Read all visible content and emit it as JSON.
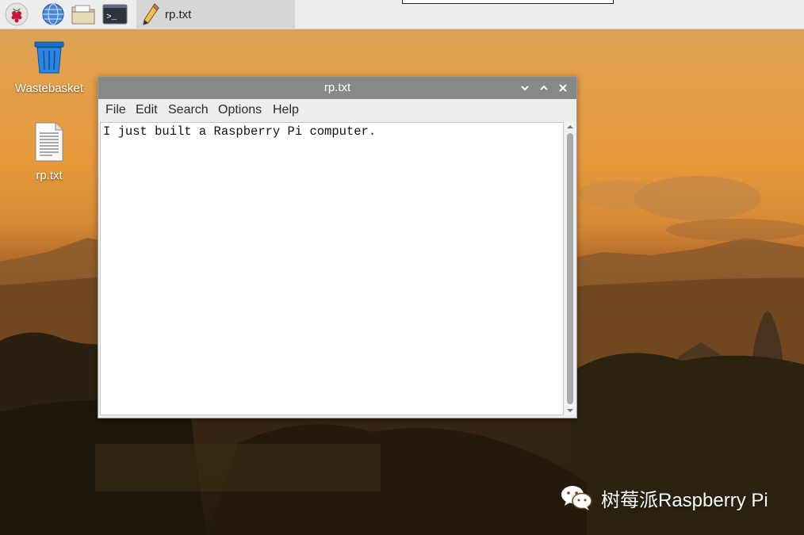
{
  "taskbar": {
    "launchers": [
      {
        "name": "raspberry-menu",
        "icon": "raspberry-icon"
      },
      {
        "name": "web-browser",
        "icon": "globe-icon"
      },
      {
        "name": "file-manager",
        "icon": "folder-icon"
      },
      {
        "name": "terminal",
        "icon": "terminal-icon",
        "glyph": ">_"
      }
    ],
    "active_task": {
      "label": "rp.txt",
      "icon": "pencil-icon"
    }
  },
  "desktop": {
    "icons": [
      {
        "label": "Wastebasket",
        "icon": "trash-icon"
      },
      {
        "label": "rp.txt",
        "icon": "text-file-icon"
      }
    ]
  },
  "window": {
    "title": "rp.txt",
    "controls": [
      "minimize-icon",
      "maximize-icon",
      "close-icon"
    ],
    "menu": [
      "File",
      "Edit",
      "Search",
      "Options",
      "Help"
    ],
    "content": "I just built a Raspberry Pi computer."
  },
  "watermark": {
    "text": "树莓派Raspberry Pi",
    "icon": "wechat-icon"
  },
  "colors": {
    "taskbar_bg": "#ededed",
    "titlebar_bg": "#888888",
    "wallpaper_sky": "#e89a3c"
  }
}
